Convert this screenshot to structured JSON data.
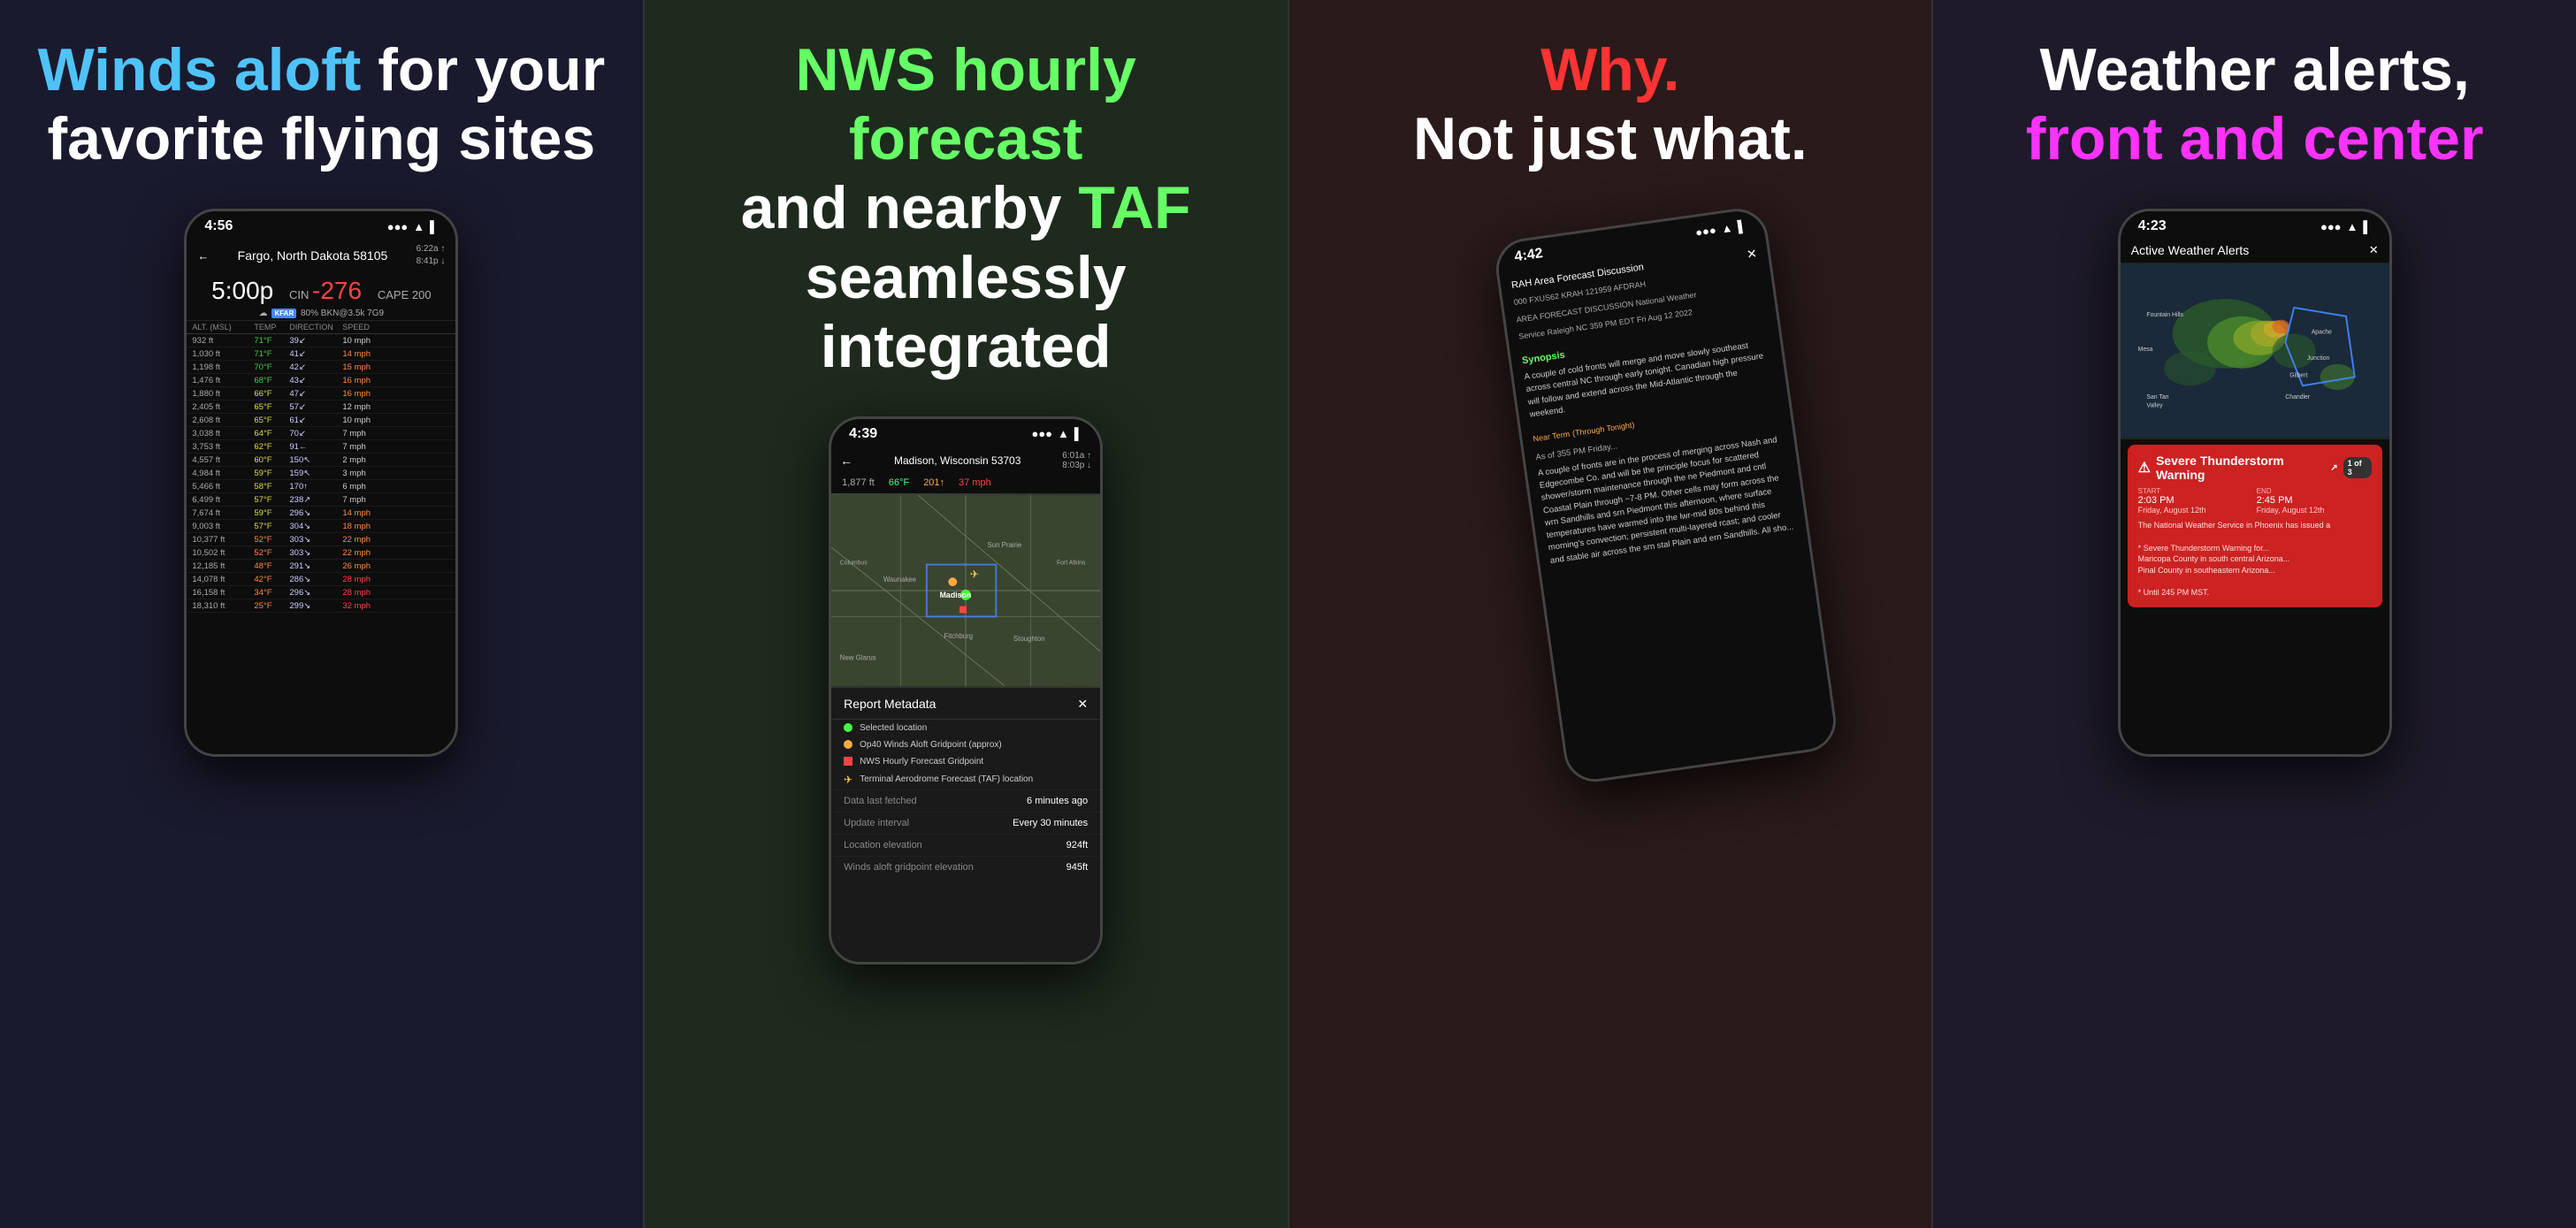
{
  "panel1": {
    "headline_part1": "Winds aloft",
    "headline_part2": " for your\nfavorite flying sites",
    "phone": {
      "status_time": "4:56",
      "status_signal": "●●●",
      "status_wifi": "▲",
      "status_battery": "▌",
      "nav_back": "←",
      "location": "Fargo, North Dakota 58105",
      "time_labels": [
        "6:22a ↑",
        "8:41p ↓"
      ],
      "main_time": "5:00p",
      "cin": "-276",
      "cape": "200",
      "sky": "80% BKN@3.5k 7G9",
      "table_headers": [
        "ALT. (MSL)",
        "TEMP",
        "DIRECTION",
        "SPEED"
      ],
      "rows": [
        {
          "alt": "932 ft",
          "temp": "71°F",
          "dir": "39↙",
          "speed": "10 mph"
        },
        {
          "alt": "1,030 ft",
          "temp": "71°F",
          "dir": "41↙",
          "speed": "14 mph",
          "speed_highlight": "orange"
        },
        {
          "alt": "1,198 ft",
          "temp": "70°F",
          "dir": "42↙",
          "speed": "15 mph",
          "speed_highlight": "orange"
        },
        {
          "alt": "1,476 ft",
          "temp": "68°F",
          "dir": "43↙",
          "speed": "16 mph",
          "speed_highlight": "orange"
        },
        {
          "alt": "1,880 ft",
          "temp": "66°F",
          "dir": "47↙",
          "speed": "16 mph",
          "speed_highlight": "orange"
        },
        {
          "alt": "2,405 ft",
          "temp": "65°F",
          "dir": "57↙",
          "speed": "12 mph"
        },
        {
          "alt": "2,608 ft",
          "temp": "65°F",
          "dir": "61↙",
          "speed": "10 mph"
        },
        {
          "alt": "3,038 ft",
          "temp": "64°F",
          "dir": "70↙",
          "speed": "7 mph"
        },
        {
          "alt": "3,753 ft",
          "temp": "62°F",
          "dir": "91←",
          "speed": "7 mph"
        },
        {
          "alt": "4,557 ft",
          "temp": "60°F",
          "dir": "150↖",
          "speed": "2 mph"
        },
        {
          "alt": "4,984 ft",
          "temp": "59°F",
          "dir": "159↖",
          "speed": "3 mph"
        },
        {
          "alt": "5,466 ft",
          "temp": "58°F",
          "dir": "170↑",
          "speed": "6 mph"
        },
        {
          "alt": "6,499 ft",
          "temp": "57°F",
          "dir": "238↗",
          "speed": "7 mph"
        },
        {
          "alt": "7,674 ft",
          "temp": "59°F",
          "dir": "296↘",
          "speed": "14 mph",
          "speed_highlight": "orange"
        },
        {
          "alt": "9,003 ft",
          "temp": "57°F",
          "dir": "304↘",
          "speed": "18 mph",
          "speed_highlight": "orange"
        },
        {
          "alt": "10,377 ft",
          "temp": "52°F",
          "dir": "303↘",
          "speed": "22 mph",
          "speed_highlight": "orange"
        },
        {
          "alt": "10,502 ft",
          "temp": "52°F",
          "dir": "303↘",
          "speed": "22 mph",
          "speed_highlight": "orange"
        },
        {
          "alt": "12,185 ft",
          "temp": "48°F",
          "dir": "291↘",
          "speed": "26 mph",
          "speed_highlight": "orange"
        },
        {
          "alt": "14,078 ft",
          "temp": "42°F",
          "dir": "286↘",
          "speed": "28 mph",
          "speed_highlight": "red"
        },
        {
          "alt": "16,158 ft",
          "temp": "34°F",
          "dir": "296↘",
          "speed": "28 mph",
          "speed_highlight": "red"
        },
        {
          "alt": "18,310 ft",
          "temp": "25°F",
          "dir": "299↘",
          "speed": "32 mph",
          "speed_highlight": "red"
        }
      ]
    }
  },
  "panel2": {
    "headline_part1": "NWS hourly forecast",
    "headline_part2": "\nand nearby ",
    "headline_taf": "TAF",
    "headline_part3": "\nseamlessly integrated",
    "phone": {
      "status_time": "4:39",
      "location": "Madison, Wisconsin 53703",
      "time_label1": "6:01a ↑",
      "time_label2": "8:03p ↓",
      "alt_val": "1,877 ft",
      "temp_val": "66°F",
      "cape_val": "201↑",
      "wind_val": "37 mph",
      "modal_title": "Report Metadata",
      "modal_close": "✕",
      "legend": [
        {
          "color": "#44ff44",
          "text": "Selected location"
        },
        {
          "color": "#ffaa44",
          "text": "Op40 Winds Aloft Gridpoint (approx)"
        },
        {
          "color": "#ff4444",
          "text": "NWS Hourly Forecast Gridpoint"
        },
        {
          "color": "#ffcc44",
          "text": "Terminal Aerodrome Forecast (TAF) location",
          "icon": "✈"
        }
      ],
      "metadata": [
        {
          "label": "Data last fetched",
          "value": "6 minutes ago"
        },
        {
          "label": "Update interval",
          "value": "Every 30 minutes"
        },
        {
          "label": "Location elevation",
          "value": "924ft"
        },
        {
          "label": "Winds aloft gridpoint elevation",
          "value": "945ft"
        }
      ]
    }
  },
  "panel3": {
    "headline_why": "Why.",
    "headline_sub": "Not just what.",
    "phone": {
      "status_time": "4:42",
      "title": "RAH Area Forecast Discussion",
      "code_line1": "000 FXUS62 KRAH 121959 AFDRAH",
      "code_line2": "AREA FORECAST DISCUSSION National Weather",
      "code_line3": "Service Raleigh NC 359 PM EDT Fri Aug 12 2022",
      "synopsis_label": "Synopsis",
      "synopsis_text": "A couple of cold fronts will merge and move slowly southeast across central NC through early tonight. Canadian high pressure will follow and extend across the Mid-Atlantic through the weekend.",
      "near_term_label": "Near Term",
      "near_term_sub": "(Through Tonight)",
      "near_term_intro": "As of 355 PM Friday...",
      "near_term_text": "A couple of fronts are in the process of merging across Nash and Edgecombe Co. and will be the principle focus for scattered shower/storm maintenance through the ne Piedmont and cntl Coastal Plain through ~7-8 PM. Other cells may form across the wrn Sandhills and srn Piedmont this afternoon, where surface temperatures have warmed into the lwr-mid 80s behind this morning's convection; persistent multi-layered rcast; and cooler and stable air across the srn stal Plain and ern Sandhills. All sho..."
    }
  },
  "panel4": {
    "headline_part1": "Weather alerts,\n",
    "headline_colored": "front and center",
    "phone": {
      "status_time": "4:23",
      "nav_title": "Active Weather Alerts",
      "nav_close": "✕",
      "alert": {
        "title": "Severe Thunderstorm Warning",
        "counter": "1 of 3",
        "start_label": "START",
        "start_time": "2:03 PM",
        "start_date": "Friday, August 12th",
        "end_label": "END",
        "end_time": "2:45 PM",
        "end_date": "Friday, August 12th",
        "body_line1": "The National Weather Service in Phoenix has issued a",
        "body_line2": "* Severe Thunderstorm Warning for...",
        "body_line3": "Maricopa County in south central Arizona...",
        "body_line4": "Pinal County in southeastern Arizona...",
        "body_line5": "* Until 245 PM MST."
      }
    }
  },
  "colors": {
    "blue_accent": "#4fc3f7",
    "green_accent": "#66ff66",
    "red_accent": "#ff3333",
    "magenta_accent": "#ff33ff",
    "orange_speed": "#ff8844",
    "red_speed": "#ff4444"
  }
}
